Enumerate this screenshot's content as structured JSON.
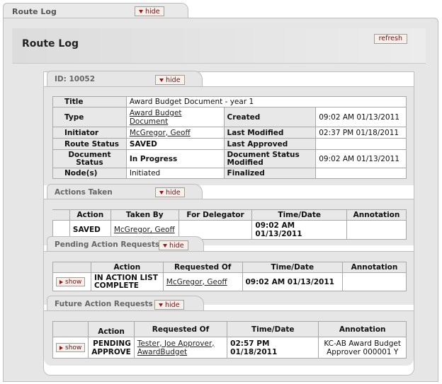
{
  "outer": {
    "title": "Route Log",
    "hide_label": "hide"
  },
  "header": {
    "title": "Route Log",
    "refresh_label": "refresh"
  },
  "doc": {
    "id_label": "ID: 10052",
    "hide_label": "hide",
    "rows": {
      "title_label": "Title",
      "title_value": "Award Budget Document - year 1",
      "type_label": "Type",
      "type_value": "Award Budget Document",
      "created_label": "Created",
      "created_value": "09:02 AM 01/13/2011",
      "initiator_label": "Initiator",
      "initiator_value": "McGregor, Geoff",
      "last_modified_label": "Last Modified",
      "last_modified_value": "02:37 PM 01/18/2011",
      "route_status_label": "Route Status",
      "route_status_value": "SAVED",
      "last_approved_label": "Last Approved",
      "last_approved_value": "",
      "doc_status_label": "Document Status",
      "doc_status_value": "In Progress",
      "doc_status_modified_label": "Document Status Modified",
      "doc_status_modified_value": "09:02 AM 01/13/2011",
      "nodes_label": "Node(s)",
      "nodes_value": "Initiated",
      "finalized_label": "Finalized",
      "finalized_value": ""
    }
  },
  "actions_taken": {
    "title": "Actions Taken",
    "hide_label": "hide",
    "headers": [
      "Action",
      "Taken By",
      "For Delegator",
      "Time/Date",
      "Annotation"
    ],
    "rows": [
      {
        "action": "SAVED",
        "taken_by": "McGregor, Geoff",
        "delegator": "",
        "time": "09:02 AM 01/13/2011",
        "annotation": ""
      }
    ]
  },
  "pending": {
    "title": "Pending Action Requests",
    "hide_label": "hide",
    "headers": [
      "Action",
      "Requested Of",
      "Time/Date",
      "Annotation"
    ],
    "rows": [
      {
        "show_label": "show",
        "action": "IN ACTION LIST COMPLETE",
        "requested_of": "McGregor, Geoff",
        "time": "09:02 AM 01/13/2011",
        "annotation": ""
      }
    ]
  },
  "future": {
    "title": "Future Action Requests",
    "hide_label": "hide",
    "headers": [
      "Action",
      "Requested Of",
      "Time/Date",
      "Annotation"
    ],
    "rows": [
      {
        "show_label": "show",
        "action": "PENDING APPROVE",
        "requested_of": "Tester, Joe Approver, AwardBudget",
        "time": "02:57 PM 01/18/2011",
        "annotation": "KC-AB Award Budget Approver 000001 Y"
      }
    ]
  }
}
